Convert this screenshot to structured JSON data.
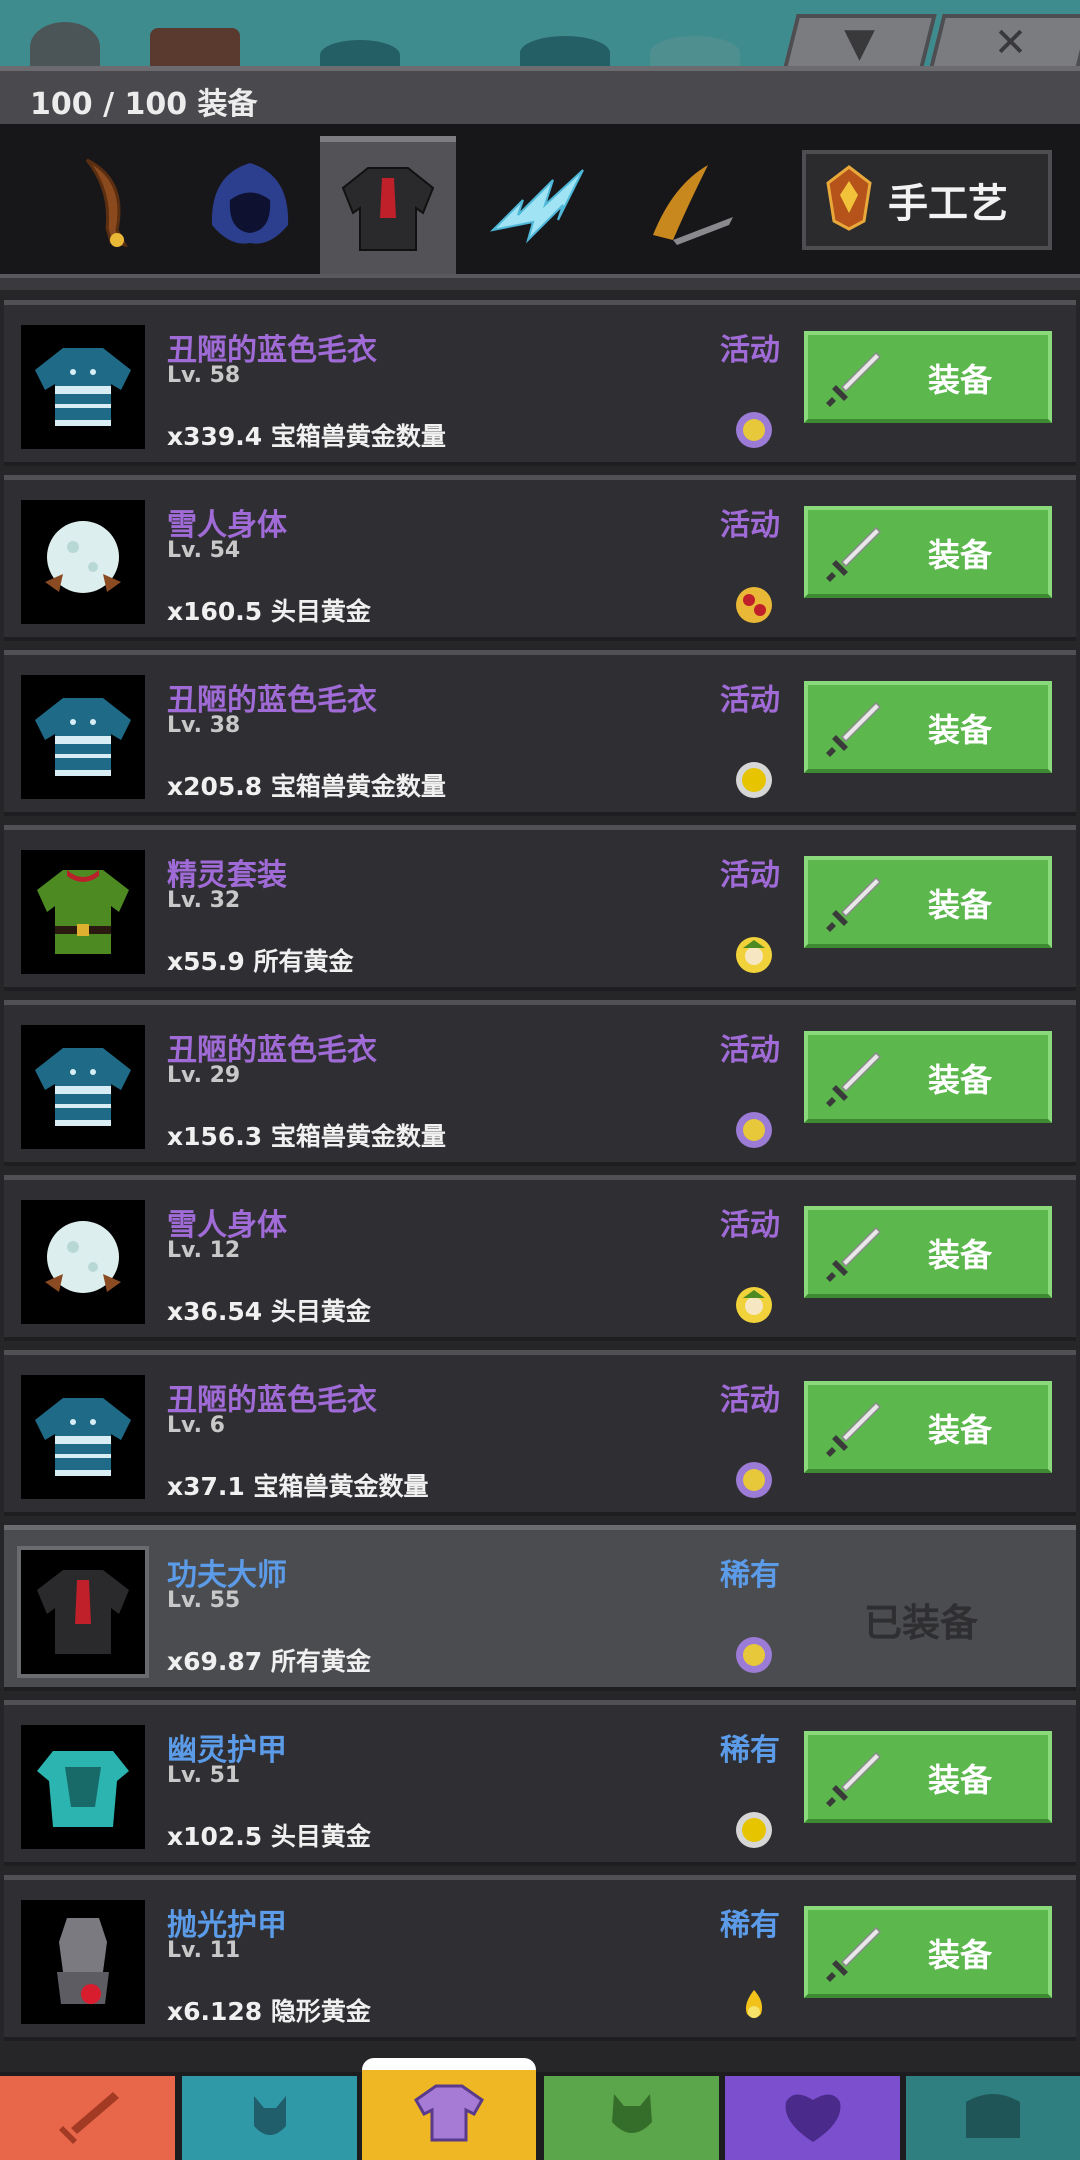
{
  "header": {
    "title": "100 / 100 装备",
    "dropdown_icon": "triangle-down-icon",
    "close_icon": "close-icon"
  },
  "categories": [
    {
      "name": "weapon",
      "icon": "bomerang-blade-icon"
    },
    {
      "name": "helmet",
      "icon": "hood-icon"
    },
    {
      "name": "armor",
      "icon": "jacket-icon",
      "active": true
    },
    {
      "name": "magic",
      "icon": "lightning-icon"
    },
    {
      "name": "slash",
      "icon": "flame-sword-icon"
    }
  ],
  "craft": {
    "label": "手工艺",
    "icon": "fire-gem-icon"
  },
  "items": [
    {
      "name": "丑陋的蓝色毛衣",
      "level": "Lv. 58",
      "bonus": "x339.4 宝箱兽黄金数量",
      "rarity": "活动",
      "rarity_color": "#a06bd6",
      "thumb": "blue-sweater",
      "coin": "purple-coin",
      "button": "装备"
    },
    {
      "name": "雪人身体",
      "level": "Lv. 54",
      "bonus": "x160.5 头目黄金",
      "rarity": "活动",
      "rarity_color": "#a06bd6",
      "thumb": "snowball",
      "coin": "boss-coin",
      "button": "装备"
    },
    {
      "name": "丑陋的蓝色毛衣",
      "level": "Lv. 38",
      "bonus": "x205.8 宝箱兽黄金数量",
      "rarity": "活动",
      "rarity_color": "#a06bd6",
      "thumb": "blue-sweater",
      "coin": "gold-coin",
      "button": "装备"
    },
    {
      "name": "精灵套装",
      "level": "Lv. 32",
      "bonus": "x55.9 所有黄金",
      "rarity": "活动",
      "rarity_color": "#a06bd6",
      "thumb": "elf-suit",
      "coin": "elf-coin",
      "button": "装备"
    },
    {
      "name": "丑陋的蓝色毛衣",
      "level": "Lv. 29",
      "bonus": "x156.3 宝箱兽黄金数量",
      "rarity": "活动",
      "rarity_color": "#a06bd6",
      "thumb": "blue-sweater",
      "coin": "purple-coin",
      "button": "装备"
    },
    {
      "name": "雪人身体",
      "level": "Lv. 12",
      "bonus": "x36.54 头目黄金",
      "rarity": "活动",
      "rarity_color": "#a06bd6",
      "thumb": "snowball",
      "coin": "elf-coin",
      "button": "装备"
    },
    {
      "name": "丑陋的蓝色毛衣",
      "level": "Lv. 6",
      "bonus": "x37.1 宝箱兽黄金数量",
      "rarity": "活动",
      "rarity_color": "#a06bd6",
      "thumb": "blue-sweater",
      "coin": "purple-coin",
      "button": "装备"
    },
    {
      "name": "功夫大师",
      "level": "Lv. 55",
      "bonus": "x69.87 所有黄金",
      "rarity": "稀有",
      "rarity_color": "#5b9be8",
      "thumb": "kungfu-jacket",
      "coin": "purple-coin",
      "equipped": true,
      "equipped_label": "已装备"
    },
    {
      "name": "幽灵护甲",
      "level": "Lv. 51",
      "bonus": "x102.5 头目黄金",
      "rarity": "稀有",
      "rarity_color": "#5b9be8",
      "thumb": "ghost-armor",
      "coin": "gold-coin",
      "button": "装备"
    },
    {
      "name": "抛光护甲",
      "level": "Lv. 11",
      "bonus": "x6.128 隐形黄金",
      "rarity": "稀有",
      "rarity_color": "#5b9be8",
      "thumb": "polished-armor",
      "coin": "flame-coin",
      "button": "装备"
    }
  ],
  "bottom_nav": [
    {
      "name": "sword",
      "color": "#e8664a",
      "icon": "sword-icon"
    },
    {
      "name": "hero",
      "color": "#2f99a8",
      "icon": "helmet-icon"
    },
    {
      "name": "equipment",
      "color": "#efb724",
      "icon": "shirt-icon",
      "active": true
    },
    {
      "name": "pets",
      "color": "#5ba64a",
      "icon": "pet-icon"
    },
    {
      "name": "clan",
      "color": "#7c4fcf",
      "icon": "heart-shield-icon"
    },
    {
      "name": "shop",
      "color": "#2f7f80",
      "icon": "chest-icon"
    }
  ]
}
